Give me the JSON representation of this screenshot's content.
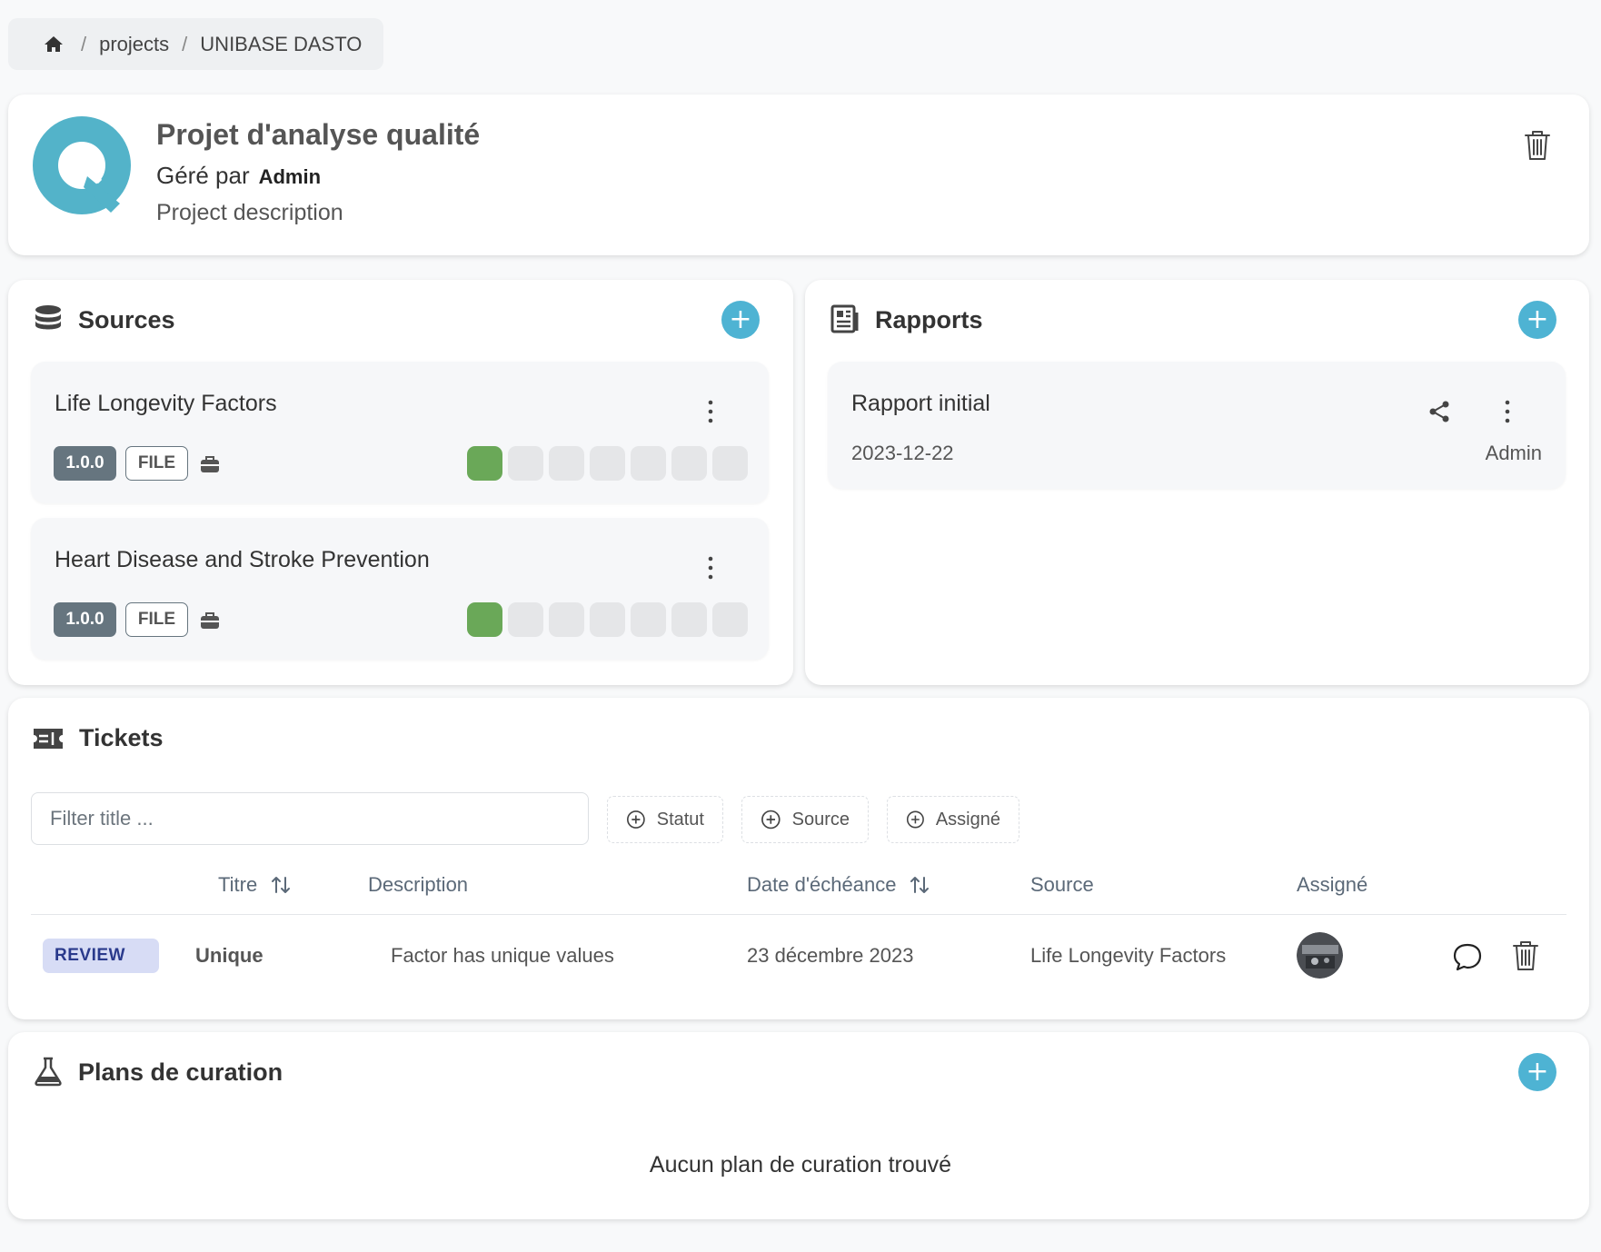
{
  "breadcrumb": {
    "home_icon": "home-icon",
    "items": [
      "projects",
      "UNIBASE DASTO"
    ],
    "separator": "/"
  },
  "project": {
    "title": "Projet d'analyse qualité",
    "managed_by_label": "Géré par",
    "manager": "Admin",
    "description": "Project description",
    "logo_color": "#53b3c9"
  },
  "sources": {
    "title": "Sources",
    "items": [
      {
        "name": "Life Longevity Factors",
        "version": "1.0.0",
        "type": "FILE",
        "steps_done": 1,
        "steps_total": 7
      },
      {
        "name": "Heart Disease and Stroke Prevention",
        "version": "1.0.0",
        "type": "FILE",
        "steps_done": 1,
        "steps_total": 7
      }
    ]
  },
  "reports": {
    "title": "Rapports",
    "items": [
      {
        "name": "Rapport initial",
        "date": "2023-12-22",
        "author": "Admin"
      }
    ]
  },
  "tickets": {
    "title": "Tickets",
    "filter_placeholder": "Filter title ...",
    "filters": [
      "Statut",
      "Source",
      "Assigné"
    ],
    "columns": {
      "title": "Titre",
      "description": "Description",
      "due_date": "Date d'échéance",
      "source": "Source",
      "assignee": "Assigné"
    },
    "rows": [
      {
        "status": "REVIEW",
        "title": "Unique",
        "description": "Factor has unique values",
        "due_date": "23 décembre 2023",
        "source": "Life Longevity Factors"
      }
    ]
  },
  "curation": {
    "title": "Plans de curation",
    "empty_message": "Aucun plan de curation trouvé"
  },
  "colors": {
    "accent": "#4eb3d3",
    "step_done": "#6aa858",
    "step_todo": "#e5e6e8",
    "review_bg": "#d7dcf5"
  }
}
